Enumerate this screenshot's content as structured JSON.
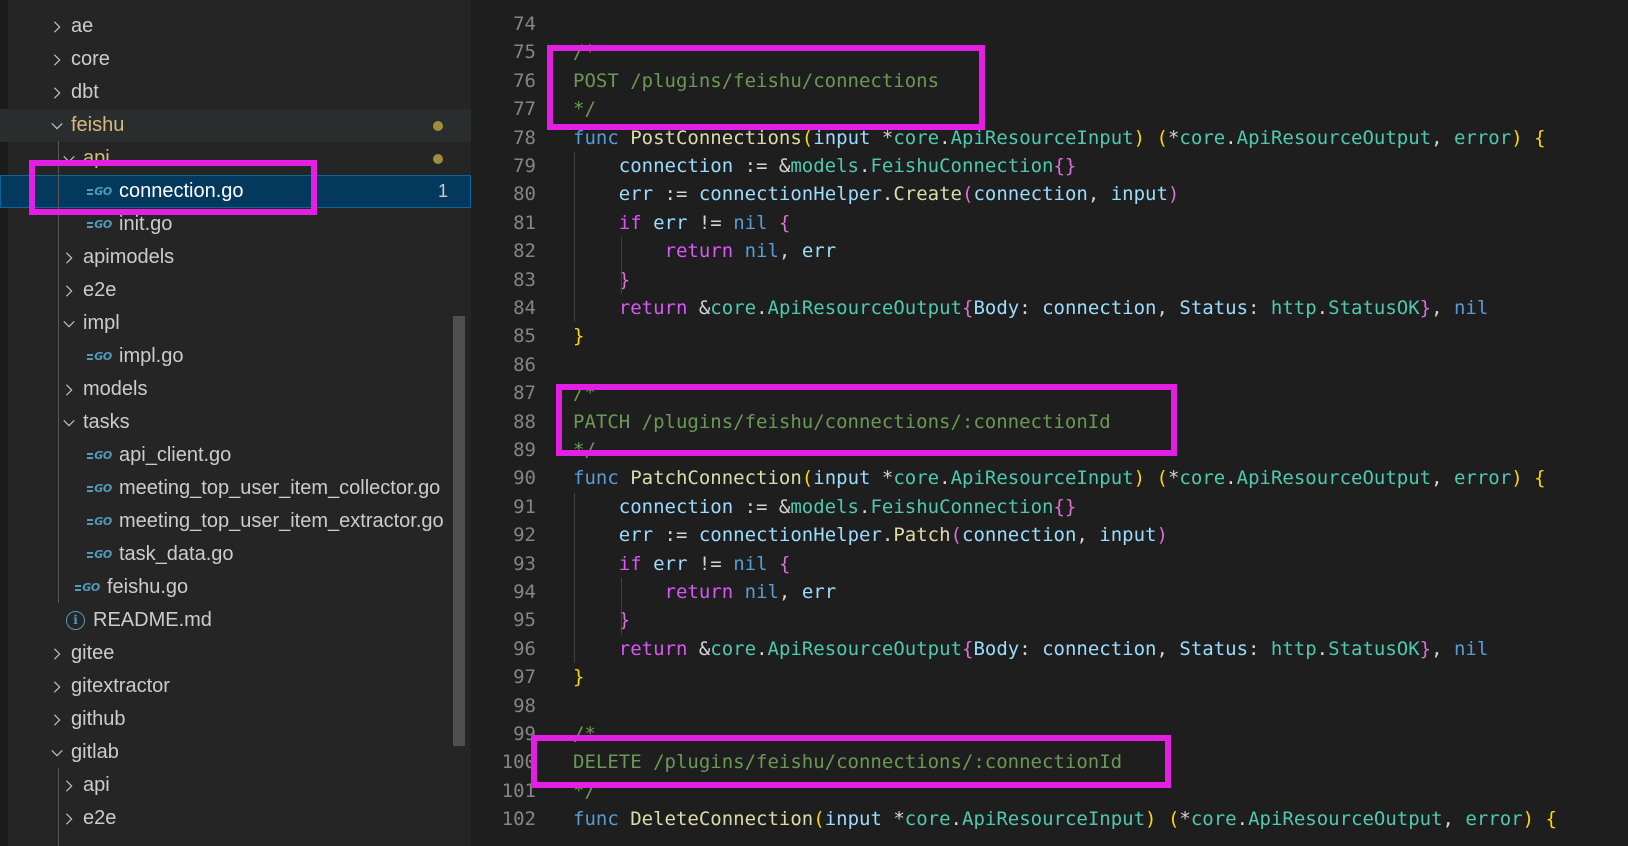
{
  "explorer": {
    "items": [
      {
        "label": "ae",
        "type": "folder",
        "expanded": false
      },
      {
        "label": "core",
        "type": "folder",
        "expanded": false
      },
      {
        "label": "dbt",
        "type": "folder",
        "expanded": false
      },
      {
        "label": "feishu",
        "type": "folder",
        "expanded": true,
        "modified": true
      },
      {
        "label": "api",
        "type": "folder",
        "expanded": true,
        "modified": true
      },
      {
        "label": "connection.go",
        "type": "go-file",
        "selected": true,
        "problems": "1"
      },
      {
        "label": "init.go",
        "type": "go-file"
      },
      {
        "label": "apimodels",
        "type": "folder",
        "expanded": false
      },
      {
        "label": "e2e",
        "type": "folder",
        "expanded": false
      },
      {
        "label": "impl",
        "type": "folder",
        "expanded": true
      },
      {
        "label": "impl.go",
        "type": "go-file"
      },
      {
        "label": "models",
        "type": "folder",
        "expanded": false
      },
      {
        "label": "tasks",
        "type": "folder",
        "expanded": true
      },
      {
        "label": "api_client.go",
        "type": "go-file"
      },
      {
        "label": "meeting_top_user_item_collector.go",
        "type": "go-file"
      },
      {
        "label": "meeting_top_user_item_extractor.go",
        "type": "go-file"
      },
      {
        "label": "task_data.go",
        "type": "go-file"
      },
      {
        "label": "feishu.go",
        "type": "go-file"
      },
      {
        "label": "README.md",
        "type": "info-file"
      },
      {
        "label": "gitee",
        "type": "folder",
        "expanded": false
      },
      {
        "label": "gitextractor",
        "type": "folder",
        "expanded": false
      },
      {
        "label": "github",
        "type": "folder",
        "expanded": false
      },
      {
        "label": "gitlab",
        "type": "folder",
        "expanded": true
      },
      {
        "label": "api",
        "type": "folder",
        "expanded": false
      },
      {
        "label": "e2e",
        "type": "folder",
        "expanded": false
      }
    ],
    "icons": {
      "go": "GO",
      "info": "i"
    },
    "colors": {
      "modified_dot": "#a08d3c",
      "selection": "#04395e",
      "highlight_box": "#e21fe3"
    }
  },
  "editor": {
    "lines": [
      {
        "n": "74",
        "tokens": []
      },
      {
        "n": "75",
        "tokens": [
          [
            "cm",
            "/*"
          ]
        ]
      },
      {
        "n": "76",
        "tokens": [
          [
            "cm",
            "POST /plugins/feishu/connections"
          ]
        ]
      },
      {
        "n": "77",
        "tokens": [
          [
            "cm",
            "*/"
          ]
        ]
      },
      {
        "n": "78",
        "tokens": [
          [
            "kb",
            "func "
          ],
          [
            "fn",
            "PostConnections"
          ],
          [
            "b1",
            "("
          ],
          [
            "va",
            "input "
          ],
          [
            "op",
            "*"
          ],
          [
            "ty",
            "core"
          ],
          [
            "op",
            "."
          ],
          [
            "ty",
            "ApiResourceInput"
          ],
          [
            "b1",
            ")"
          ],
          [
            "op",
            " "
          ],
          [
            "b1",
            "("
          ],
          [
            "op",
            "*"
          ],
          [
            "ty",
            "core"
          ],
          [
            "op",
            "."
          ],
          [
            "ty",
            "ApiResourceOutput"
          ],
          [
            "op",
            ", "
          ],
          [
            "ty",
            "error"
          ],
          [
            "b1",
            ")"
          ],
          [
            "op",
            " "
          ],
          [
            "b1",
            "{"
          ]
        ]
      },
      {
        "n": "79",
        "tokens": [
          [
            "op",
            "    "
          ],
          [
            "va",
            "connection"
          ],
          [
            "op",
            " := &"
          ],
          [
            "ty",
            "models"
          ],
          [
            "op",
            "."
          ],
          [
            "ty",
            "FeishuConnection"
          ],
          [
            "b2",
            "{}"
          ]
        ]
      },
      {
        "n": "80",
        "tokens": [
          [
            "op",
            "    "
          ],
          [
            "va",
            "err"
          ],
          [
            "op",
            " := "
          ],
          [
            "va",
            "connectionHelper"
          ],
          [
            "op",
            "."
          ],
          [
            "fn",
            "Create"
          ],
          [
            "b2",
            "("
          ],
          [
            "va",
            "connection"
          ],
          [
            "op",
            ", "
          ],
          [
            "va",
            "input"
          ],
          [
            "b2",
            ")"
          ]
        ]
      },
      {
        "n": "81",
        "tokens": [
          [
            "op",
            "    "
          ],
          [
            "kw",
            "if "
          ],
          [
            "va",
            "err"
          ],
          [
            "op",
            " != "
          ],
          [
            "kb",
            "nil"
          ],
          [
            "op",
            " "
          ],
          [
            "b2",
            "{"
          ]
        ]
      },
      {
        "n": "82",
        "tokens": [
          [
            "op",
            "        "
          ],
          [
            "kw",
            "return "
          ],
          [
            "kb",
            "nil"
          ],
          [
            "op",
            ", "
          ],
          [
            "va",
            "err"
          ]
        ]
      },
      {
        "n": "83",
        "tokens": [
          [
            "op",
            "    "
          ],
          [
            "b2",
            "}"
          ]
        ]
      },
      {
        "n": "84",
        "tokens": [
          [
            "op",
            "    "
          ],
          [
            "kw",
            "return "
          ],
          [
            "op",
            "&"
          ],
          [
            "ty",
            "core"
          ],
          [
            "op",
            "."
          ],
          [
            "ty",
            "ApiResourceOutput"
          ],
          [
            "b2",
            "{"
          ],
          [
            "va",
            "Body"
          ],
          [
            "op",
            ": "
          ],
          [
            "va",
            "connection"
          ],
          [
            "op",
            ", "
          ],
          [
            "va",
            "Status"
          ],
          [
            "op",
            ": "
          ],
          [
            "ty",
            "http"
          ],
          [
            "op",
            "."
          ],
          [
            "ty",
            "StatusOK"
          ],
          [
            "b2",
            "}"
          ],
          [
            "op",
            ", "
          ],
          [
            "kb",
            "nil"
          ]
        ]
      },
      {
        "n": "85",
        "tokens": [
          [
            "b1",
            "}"
          ]
        ]
      },
      {
        "n": "86",
        "tokens": []
      },
      {
        "n": "87",
        "tokens": [
          [
            "cm",
            "/*"
          ]
        ]
      },
      {
        "n": "88",
        "tokens": [
          [
            "cm",
            "PATCH /plugins/feishu/connections/:connectionId"
          ]
        ]
      },
      {
        "n": "89",
        "tokens": [
          [
            "cm",
            "*/"
          ]
        ]
      },
      {
        "n": "90",
        "tokens": [
          [
            "kb",
            "func "
          ],
          [
            "fn",
            "PatchConnection"
          ],
          [
            "b1",
            "("
          ],
          [
            "va",
            "input "
          ],
          [
            "op",
            "*"
          ],
          [
            "ty",
            "core"
          ],
          [
            "op",
            "."
          ],
          [
            "ty",
            "ApiResourceInput"
          ],
          [
            "b1",
            ")"
          ],
          [
            "op",
            " "
          ],
          [
            "b1",
            "("
          ],
          [
            "op",
            "*"
          ],
          [
            "ty",
            "core"
          ],
          [
            "op",
            "."
          ],
          [
            "ty",
            "ApiResourceOutput"
          ],
          [
            "op",
            ", "
          ],
          [
            "ty",
            "error"
          ],
          [
            "b1",
            ")"
          ],
          [
            "op",
            " "
          ],
          [
            "b1",
            "{"
          ]
        ]
      },
      {
        "n": "91",
        "tokens": [
          [
            "op",
            "    "
          ],
          [
            "va",
            "connection"
          ],
          [
            "op",
            " := &"
          ],
          [
            "ty",
            "models"
          ],
          [
            "op",
            "."
          ],
          [
            "ty",
            "FeishuConnection"
          ],
          [
            "b2",
            "{}"
          ]
        ]
      },
      {
        "n": "92",
        "tokens": [
          [
            "op",
            "    "
          ],
          [
            "va",
            "err"
          ],
          [
            "op",
            " := "
          ],
          [
            "va",
            "connectionHelper"
          ],
          [
            "op",
            "."
          ],
          [
            "fn",
            "Patch"
          ],
          [
            "b2",
            "("
          ],
          [
            "va",
            "connection"
          ],
          [
            "op",
            ", "
          ],
          [
            "va",
            "input"
          ],
          [
            "b2",
            ")"
          ]
        ]
      },
      {
        "n": "93",
        "tokens": [
          [
            "op",
            "    "
          ],
          [
            "kw",
            "if "
          ],
          [
            "va",
            "err"
          ],
          [
            "op",
            " != "
          ],
          [
            "kb",
            "nil"
          ],
          [
            "op",
            " "
          ],
          [
            "b2",
            "{"
          ]
        ]
      },
      {
        "n": "94",
        "tokens": [
          [
            "op",
            "        "
          ],
          [
            "kw",
            "return "
          ],
          [
            "kb",
            "nil"
          ],
          [
            "op",
            ", "
          ],
          [
            "va",
            "err"
          ]
        ]
      },
      {
        "n": "95",
        "tokens": [
          [
            "op",
            "    "
          ],
          [
            "b2",
            "}"
          ]
        ]
      },
      {
        "n": "96",
        "tokens": [
          [
            "op",
            "    "
          ],
          [
            "kw",
            "return "
          ],
          [
            "op",
            "&"
          ],
          [
            "ty",
            "core"
          ],
          [
            "op",
            "."
          ],
          [
            "ty",
            "ApiResourceOutput"
          ],
          [
            "b2",
            "{"
          ],
          [
            "va",
            "Body"
          ],
          [
            "op",
            ": "
          ],
          [
            "va",
            "connection"
          ],
          [
            "op",
            ", "
          ],
          [
            "va",
            "Status"
          ],
          [
            "op",
            ": "
          ],
          [
            "ty",
            "http"
          ],
          [
            "op",
            "."
          ],
          [
            "ty",
            "StatusOK"
          ],
          [
            "b2",
            "}"
          ],
          [
            "op",
            ", "
          ],
          [
            "kb",
            "nil"
          ]
        ]
      },
      {
        "n": "97",
        "tokens": [
          [
            "b1",
            "}"
          ]
        ]
      },
      {
        "n": "98",
        "tokens": []
      },
      {
        "n": "99",
        "tokens": [
          [
            "cm",
            "/*"
          ]
        ]
      },
      {
        "n": "100",
        "tokens": [
          [
            "cm",
            "DELETE /plugins/feishu/connections/:connectionId"
          ]
        ]
      },
      {
        "n": "101",
        "tokens": [
          [
            "cm",
            "*/"
          ]
        ]
      },
      {
        "n": "102",
        "tokens": [
          [
            "kb",
            "func "
          ],
          [
            "fn",
            "DeleteConnection"
          ],
          [
            "b1",
            "("
          ],
          [
            "va",
            "input "
          ],
          [
            "op",
            "*"
          ],
          [
            "ty",
            "core"
          ],
          [
            "op",
            "."
          ],
          [
            "ty",
            "ApiResourceInput"
          ],
          [
            "b1",
            ")"
          ],
          [
            "op",
            " "
          ],
          [
            "b1",
            "("
          ],
          [
            "op",
            "*"
          ],
          [
            "ty",
            "core"
          ],
          [
            "op",
            "."
          ],
          [
            "ty",
            "ApiResourceOutput"
          ],
          [
            "op",
            ", "
          ],
          [
            "ty",
            "error"
          ],
          [
            "b1",
            ")"
          ],
          [
            "op",
            " "
          ],
          [
            "b1",
            "{"
          ]
        ]
      }
    ]
  }
}
